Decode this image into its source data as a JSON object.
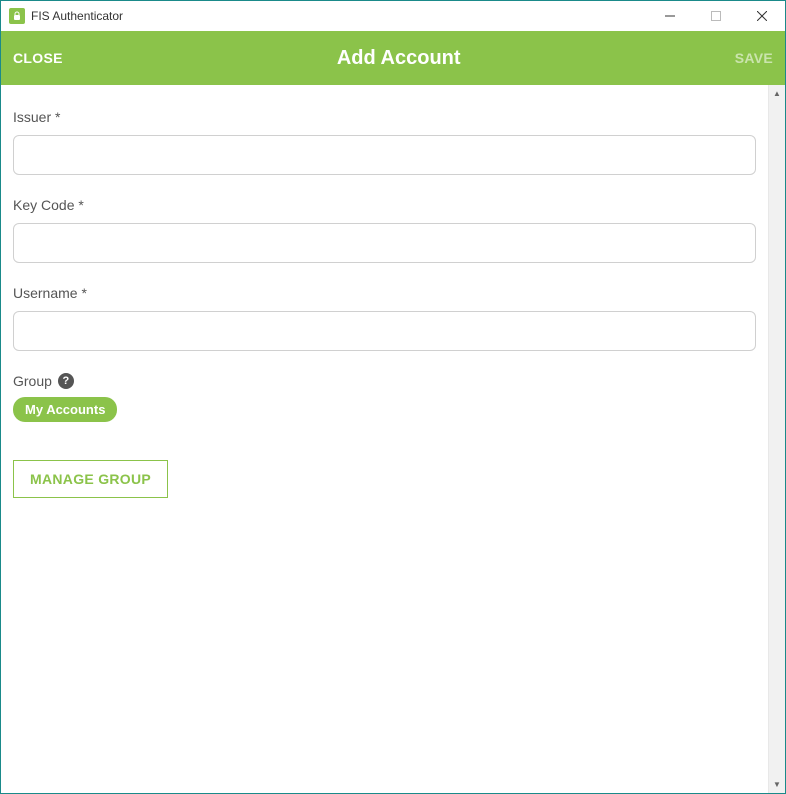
{
  "window": {
    "title": "FIS Authenticator"
  },
  "header": {
    "close_label": "CLOSE",
    "title": "Add Account",
    "save_label": "SAVE"
  },
  "form": {
    "issuer": {
      "label": "Issuer *",
      "value": ""
    },
    "key_code": {
      "label": "Key Code *",
      "value": ""
    },
    "username": {
      "label": "Username *",
      "value": ""
    },
    "group": {
      "label": "Group",
      "selected": "My Accounts"
    },
    "manage_group_label": "MANAGE GROUP"
  },
  "colors": {
    "accent": "#8bc34a",
    "window_border": "#1a8a8a"
  }
}
